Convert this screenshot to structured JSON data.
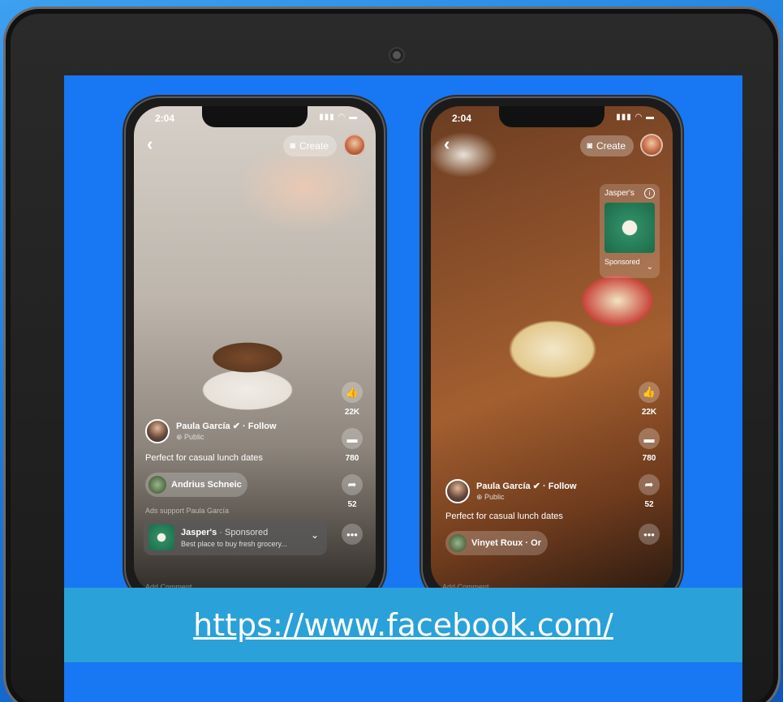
{
  "url": "https://www.facebook.com/",
  "phones": [
    {
      "status_time": "2:04",
      "create_label": "Create",
      "author_name": "Paula García",
      "follow_label": "· Follow",
      "visibility": "Public",
      "caption": "Perfect for casual lunch dates",
      "music_label": "Andrius Schneic",
      "likes": "22K",
      "comments": "780",
      "shares": "52",
      "ads_support": "Ads support Paula García",
      "ad_brand": "Jasper's",
      "ad_sponsored": "· Sponsored",
      "ad_description": "Best place to buy fresh grocery...",
      "add_comment": "Add Comment"
    },
    {
      "status_time": "2:04",
      "create_label": "Create",
      "author_name": "Paula García",
      "follow_label": "· Follow",
      "visibility": "Public",
      "caption": "Perfect for casual lunch dates",
      "music_label": "Vinyet Roux · Or",
      "likes": "22K",
      "comments": "780",
      "shares": "52",
      "sponsored_brand": "Jasper's",
      "sponsored_label": "Sponsored",
      "add_comment": "Add Comment"
    }
  ]
}
